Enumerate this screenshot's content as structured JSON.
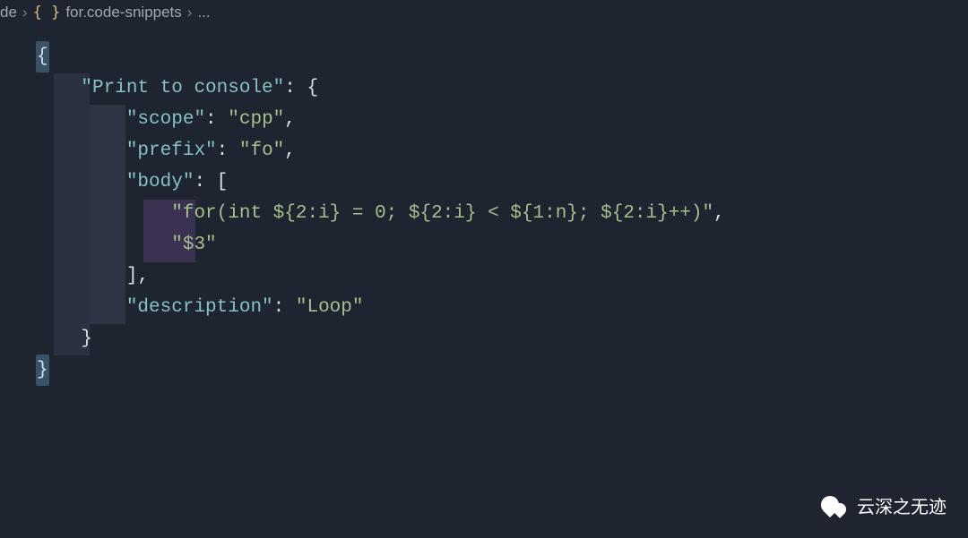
{
  "breadcrumb": {
    "folder_partial": "de",
    "icon_label": "{ }",
    "filename": "for.code-snippets",
    "tail": "..."
  },
  "code": {
    "l1": {
      "brace": "{"
    },
    "l2": {
      "key": "\"Print to console\"",
      "colon": ": ",
      "brace": "{"
    },
    "l3": {
      "key": "\"scope\"",
      "colon": ": ",
      "val": "\"cpp\"",
      "comma": ","
    },
    "l4": {
      "key": "\"prefix\"",
      "colon": ": ",
      "val": "\"fo\"",
      "comma": ","
    },
    "l5": {
      "key": "\"body\"",
      "colon": ": ",
      "bracket": "["
    },
    "l6": {
      "val": "\"for(int ${2:i} = 0; ${2:i} < ${1:n}; ${2:i}++)\"",
      "comma": ","
    },
    "l7": {
      "val": "\"$3\""
    },
    "l8": {
      "bracket": "]",
      "comma": ","
    },
    "l9": {
      "key": "\"description\"",
      "colon": ": ",
      "val": "\"Loop\""
    },
    "l10": {
      "brace": "}"
    },
    "l11": {
      "brace": "}"
    }
  },
  "watermark": {
    "text": "云深之无迹"
  }
}
